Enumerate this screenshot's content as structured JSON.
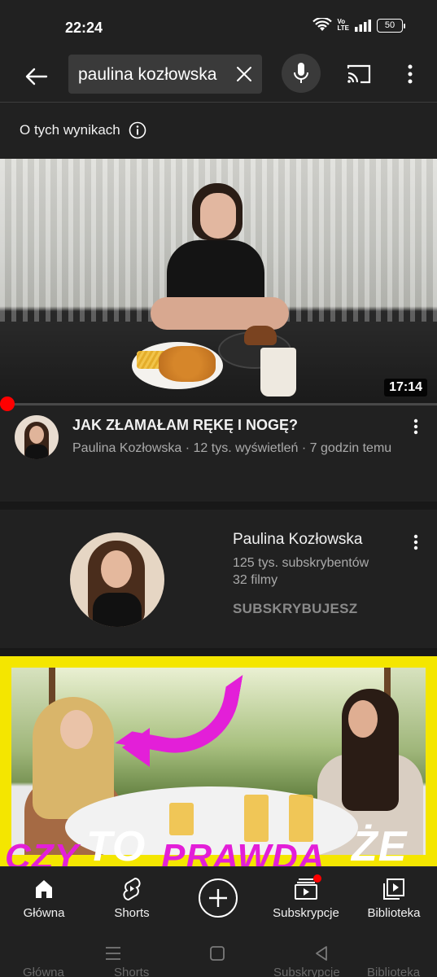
{
  "status_bar": {
    "time": "22:24",
    "battery": "50",
    "network": "Vo LTE"
  },
  "search": {
    "query": "paulina kozłowska"
  },
  "about_results": {
    "label": "O tych wynikach"
  },
  "video1": {
    "duration": "17:14",
    "title": "JAK ZŁAMAŁAM RĘKĘ I NOGĘ?",
    "meta": "Paulina Kozłowska · 12 tys. wyświetleń · 7 godzin temu"
  },
  "channel": {
    "name": "Paulina Kozłowska",
    "subscribers": "125 tys. subskrybentów",
    "videos": "32 filmy",
    "subscribe_state": "SUBSKRYBUJESZ"
  },
  "video2": {
    "thumbnail_text_1": "CZY",
    "thumbnail_text_2": "TO",
    "thumbnail_text_3": "PRAWDA",
    "thumbnail_text_4": "ŻE"
  },
  "bottom_nav": {
    "items": [
      {
        "label": "Główna",
        "icon": "home-icon"
      },
      {
        "label": "Shorts",
        "icon": "shorts-icon"
      },
      {
        "label": "",
        "icon": "create-icon"
      },
      {
        "label": "Subskrypcje",
        "icon": "subscriptions-icon"
      },
      {
        "label": "Biblioteka",
        "icon": "library-icon"
      }
    ]
  },
  "ghost_labels": [
    "Główna",
    "Shorts",
    "Subskrypcje",
    "Biblioteka"
  ],
  "colors": {
    "background": "#212121",
    "accent_red": "#ff0000",
    "secondary_text": "#aaaaaa",
    "thumbnail_pink": "#e31fd8",
    "thumbnail_yellow": "#f4e600"
  }
}
